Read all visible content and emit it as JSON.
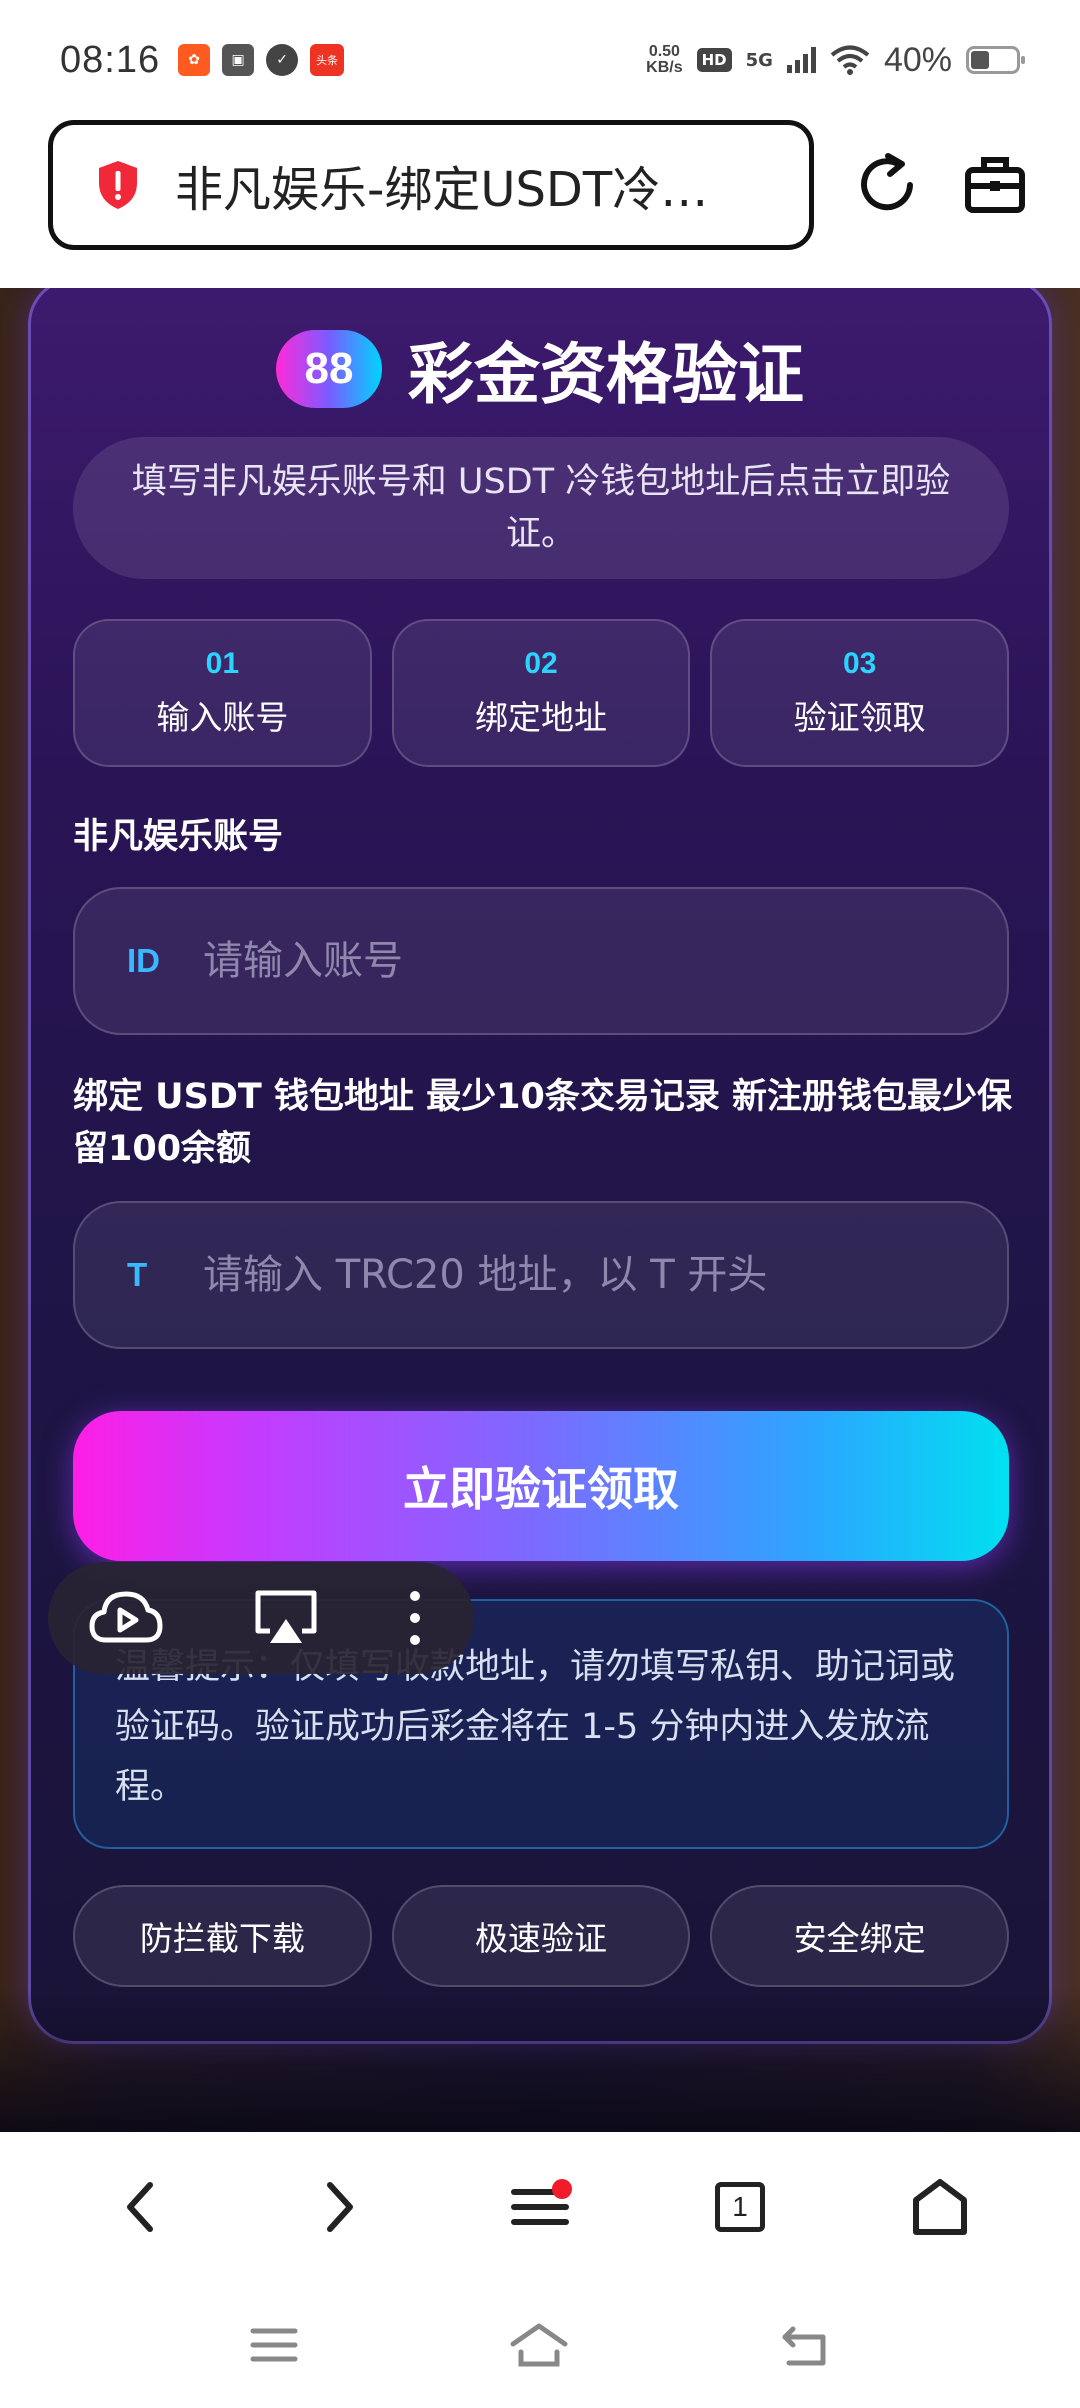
{
  "status_bar": {
    "time": "08:16",
    "net_speed_value": "0.50",
    "net_speed_unit": "KB/s",
    "hd_label": "HD",
    "network_label": "5G",
    "battery_percent": "40%",
    "notif_news_label": "头条"
  },
  "browser": {
    "url_text": "非凡娱乐-绑定USDT冷…",
    "security_icon": "shield-alert-icon"
  },
  "card": {
    "badge": "88",
    "title": "彩金资格验证",
    "description": "填写非凡娱乐账号和 USDT 冷钱包地址后点击立即验证。",
    "steps": [
      {
        "num": "01",
        "label": "输入账号"
      },
      {
        "num": "02",
        "label": "绑定地址"
      },
      {
        "num": "03",
        "label": "验证领取"
      }
    ],
    "account": {
      "label": "非凡娱乐账号",
      "prefix": "ID",
      "placeholder": "请输入账号"
    },
    "wallet": {
      "label": "绑定 USDT 钱包地址 最少10条交易记录 新注册钱包最少保留100余额",
      "prefix": "T",
      "placeholder": "请输入 TRC20 地址，以 T 开头"
    },
    "submit_label": "立即验证领取",
    "tip": "温馨提示：仅填写收款地址，请勿填写私钥、助记词或验证码。验证成功后彩金将在 1-5 分钟内进入发放流程。",
    "features": [
      "防拦截下载",
      "极速验证",
      "安全绑定"
    ]
  },
  "bottom_nav": {
    "tab_count": "1"
  },
  "colors": {
    "accent_cyan": "#2ad4ff",
    "accent_pink": "#ff1ee6",
    "card_bg": "#2a1456"
  }
}
